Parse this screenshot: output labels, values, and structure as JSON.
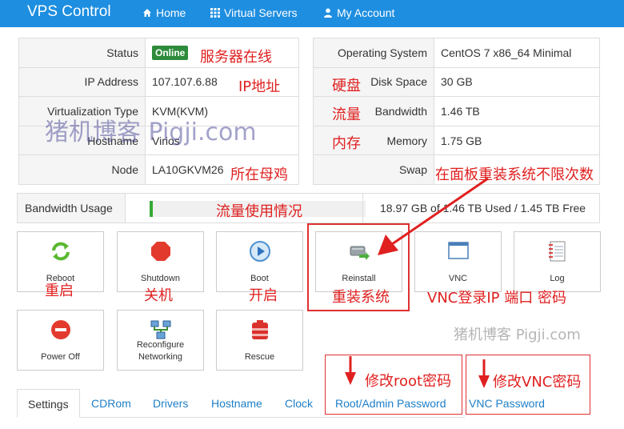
{
  "header": {
    "brand": "VPS Control",
    "nav": [
      {
        "label": "Home",
        "icon": "home-icon"
      },
      {
        "label": "Virtual Servers",
        "icon": "grid-icon"
      },
      {
        "label": "My Account",
        "icon": "user-icon"
      }
    ],
    "bg_color": "#1e8ee0"
  },
  "server_info": {
    "left": [
      {
        "label": "Status",
        "value": "Online"
      },
      {
        "label": "IP Address",
        "value": "107.107.6.88"
      },
      {
        "label": "Virtualization Type",
        "value": "KVM(KVM)"
      },
      {
        "label": "Hostname",
        "value": "Virios"
      },
      {
        "label": "Node",
        "value": "LA10GKVM26"
      }
    ],
    "right": [
      {
        "label": "Operating System",
        "value": "CentOS 7 x86_64 Minimal"
      },
      {
        "label": "Disk Space",
        "value": "30 GB"
      },
      {
        "label": "Bandwidth",
        "value": "1.46 TB"
      },
      {
        "label": "Memory",
        "value": "1.75 GB"
      },
      {
        "label": "Swap",
        "value": ""
      }
    ]
  },
  "bandwidth_usage": {
    "label": "Bandwidth Usage",
    "used_fraction": 0.013,
    "summary": "18.97 GB of 1.46 TB Used / 1.45 TB Free"
  },
  "actions": [
    {
      "label": "Reboot",
      "icon": "reboot-icon"
    },
    {
      "label": "Shutdown",
      "icon": "shutdown-icon"
    },
    {
      "label": "Boot",
      "icon": "boot-icon"
    },
    {
      "label": "Reinstall",
      "icon": "reinstall-icon"
    },
    {
      "label": "VNC",
      "icon": "vnc-icon"
    },
    {
      "label": "Log",
      "icon": "log-icon"
    },
    {
      "label": "Power Off",
      "icon": "power-off-icon"
    },
    {
      "label": "Reconfigure Networking",
      "icon": "network-icon"
    },
    {
      "label": "Rescue",
      "icon": "rescue-icon"
    }
  ],
  "tabs": [
    {
      "label": "Settings",
      "active": true
    },
    {
      "label": "CDRom"
    },
    {
      "label": "Drivers"
    },
    {
      "label": "Hostname"
    },
    {
      "label": "Clock"
    },
    {
      "label": "Root/Admin Password"
    },
    {
      "label": "VNC Password"
    }
  ],
  "annotations": {
    "status": "服务器在线",
    "ip": "IP地址",
    "node": "所在母鸡",
    "disk": "硬盘",
    "bandwidth": "流量",
    "memory": "内存",
    "reinstall_panel": "在面板重装系统不限次数",
    "bw_usage": "流量使用情况",
    "reboot": "重启",
    "shutdown": "关机",
    "boot": "开启",
    "reinstall": "重装系统",
    "vnc": "VNC登录IP 端口 密码",
    "root_pw": "修改root密码",
    "vnc_pw": "修改VNC密码",
    "color": "#e02020"
  },
  "watermarks": {
    "large": "猪机博客 Pigji.com",
    "small": "猪机博客 Pigji.com"
  }
}
